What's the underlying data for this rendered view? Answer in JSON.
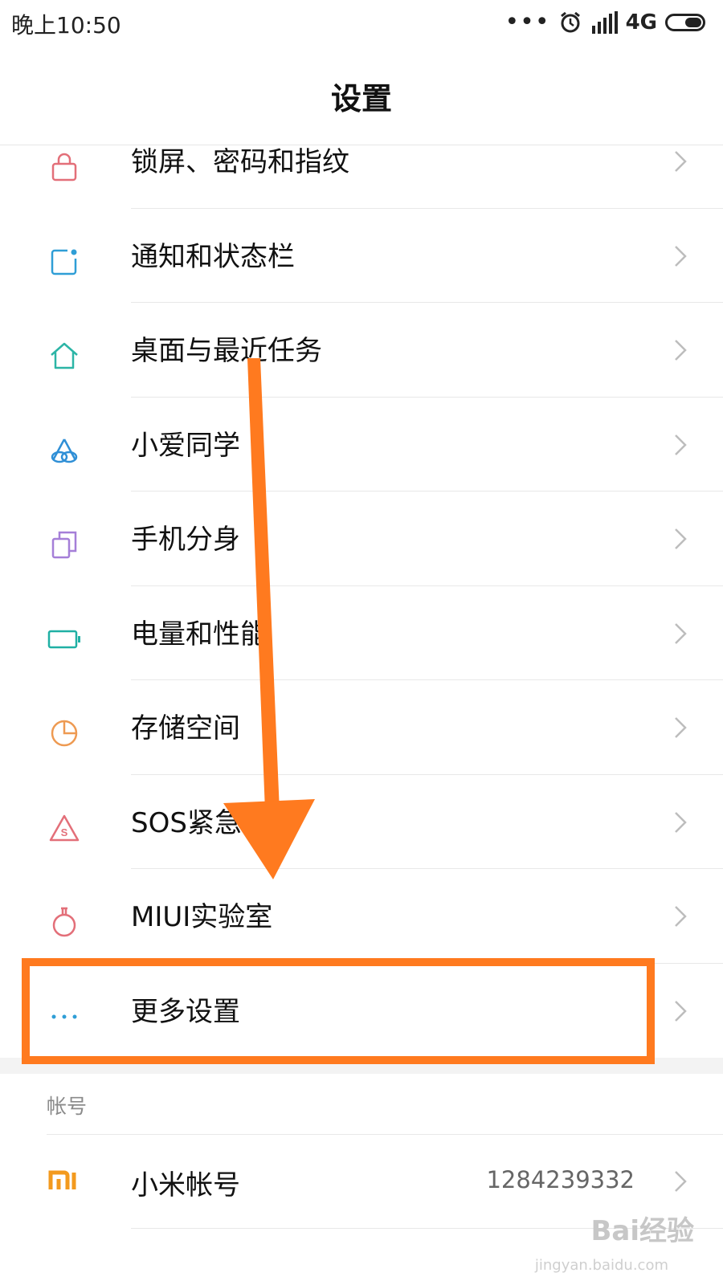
{
  "status_bar": {
    "time": "晚上10:50",
    "network": "4G"
  },
  "page": {
    "title": "设置"
  },
  "menu_items": [
    {
      "label": "锁屏、密码和指纹",
      "icon": "lock-icon",
      "color": "#e36f79"
    },
    {
      "label": "通知和状态栏",
      "icon": "notification-icon",
      "color": "#2f9ed6"
    },
    {
      "label": "桌面与最近任务",
      "icon": "home-icon",
      "color": "#2cb5a6"
    },
    {
      "label": "小爱同学",
      "icon": "xiaoai-icon",
      "color": "#2f8fd6"
    },
    {
      "label": "手机分身",
      "icon": "clone-icon",
      "color": "#a57fd8"
    },
    {
      "label": "电量和性能",
      "icon": "battery-icon",
      "color": "#1fb0a4"
    },
    {
      "label": "存储空间",
      "icon": "storage-pie-icon",
      "color": "#ee9a52"
    },
    {
      "label": "SOS紧急求助",
      "icon": "sos-icon",
      "color": "#e36f79"
    },
    {
      "label": "MIUI实验室",
      "icon": "flask-icon",
      "color": "#e36f79"
    },
    {
      "label": "更多设置",
      "icon": "more-icon",
      "color": "#2f9ed6"
    }
  ],
  "account_section": {
    "header": "帐号",
    "item": {
      "label": "小米帐号",
      "value": "1284239332",
      "icon_text": "mi"
    }
  },
  "annotation": {
    "color": "#ff7a1f"
  },
  "watermark": {
    "text": "Bai经验",
    "sub": "jingyan.baidu.com"
  }
}
